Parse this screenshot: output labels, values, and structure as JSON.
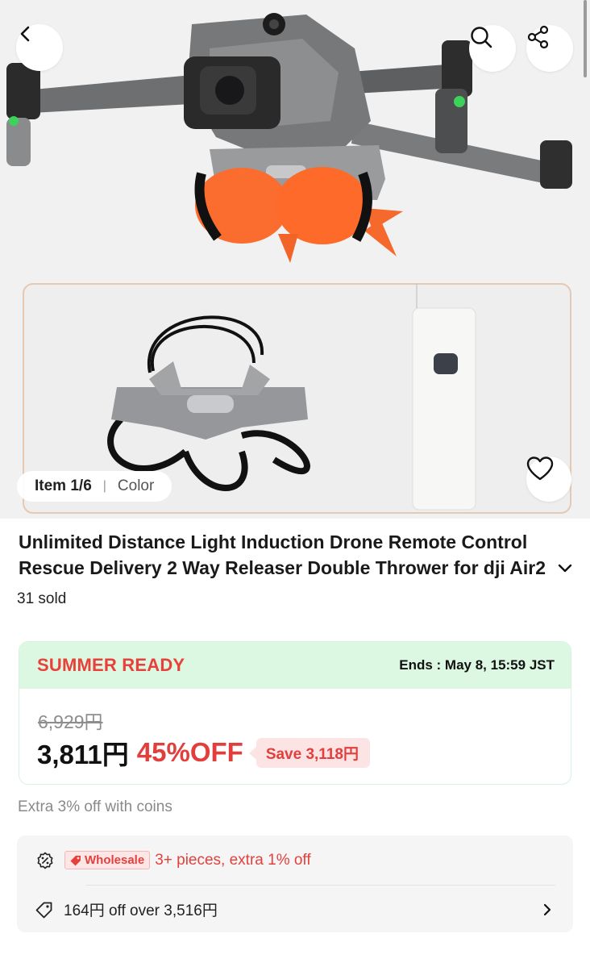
{
  "product": {
    "item_indicator": "Item 1/6",
    "variant_label": "Color",
    "title_line1": "Unlimited Distance Light Induction Drone Remote Control",
    "title_line2": "Rescue Delivery 2 Way Releaser Double Thrower for dji Air2",
    "sold": "31 sold"
  },
  "promo": {
    "name": "SUMMER READY",
    "ends": "Ends : May 8, 15:59 JST",
    "original_price": "6,929円",
    "current_price": "3,811円",
    "discount": "45%OFF",
    "save": "Save 3,118円",
    "accent_color": "#e23e3b",
    "banner_color": "#dcf8e3"
  },
  "coins_note": "Extra 3% off with coins",
  "offers": {
    "wholesale_tag": "Wholesale",
    "wholesale_text": "3+ pieces, extra 1% off",
    "coupon_text": "164円 off over 3,516円"
  },
  "icons": {
    "back": "chevron-left-icon",
    "search": "search-icon",
    "share": "share-icon",
    "favorite": "heart-icon",
    "expand": "chevron-down-icon",
    "wholesale": "discount-badge-icon",
    "coupon": "tag-icon",
    "more": "chevron-right-icon"
  }
}
